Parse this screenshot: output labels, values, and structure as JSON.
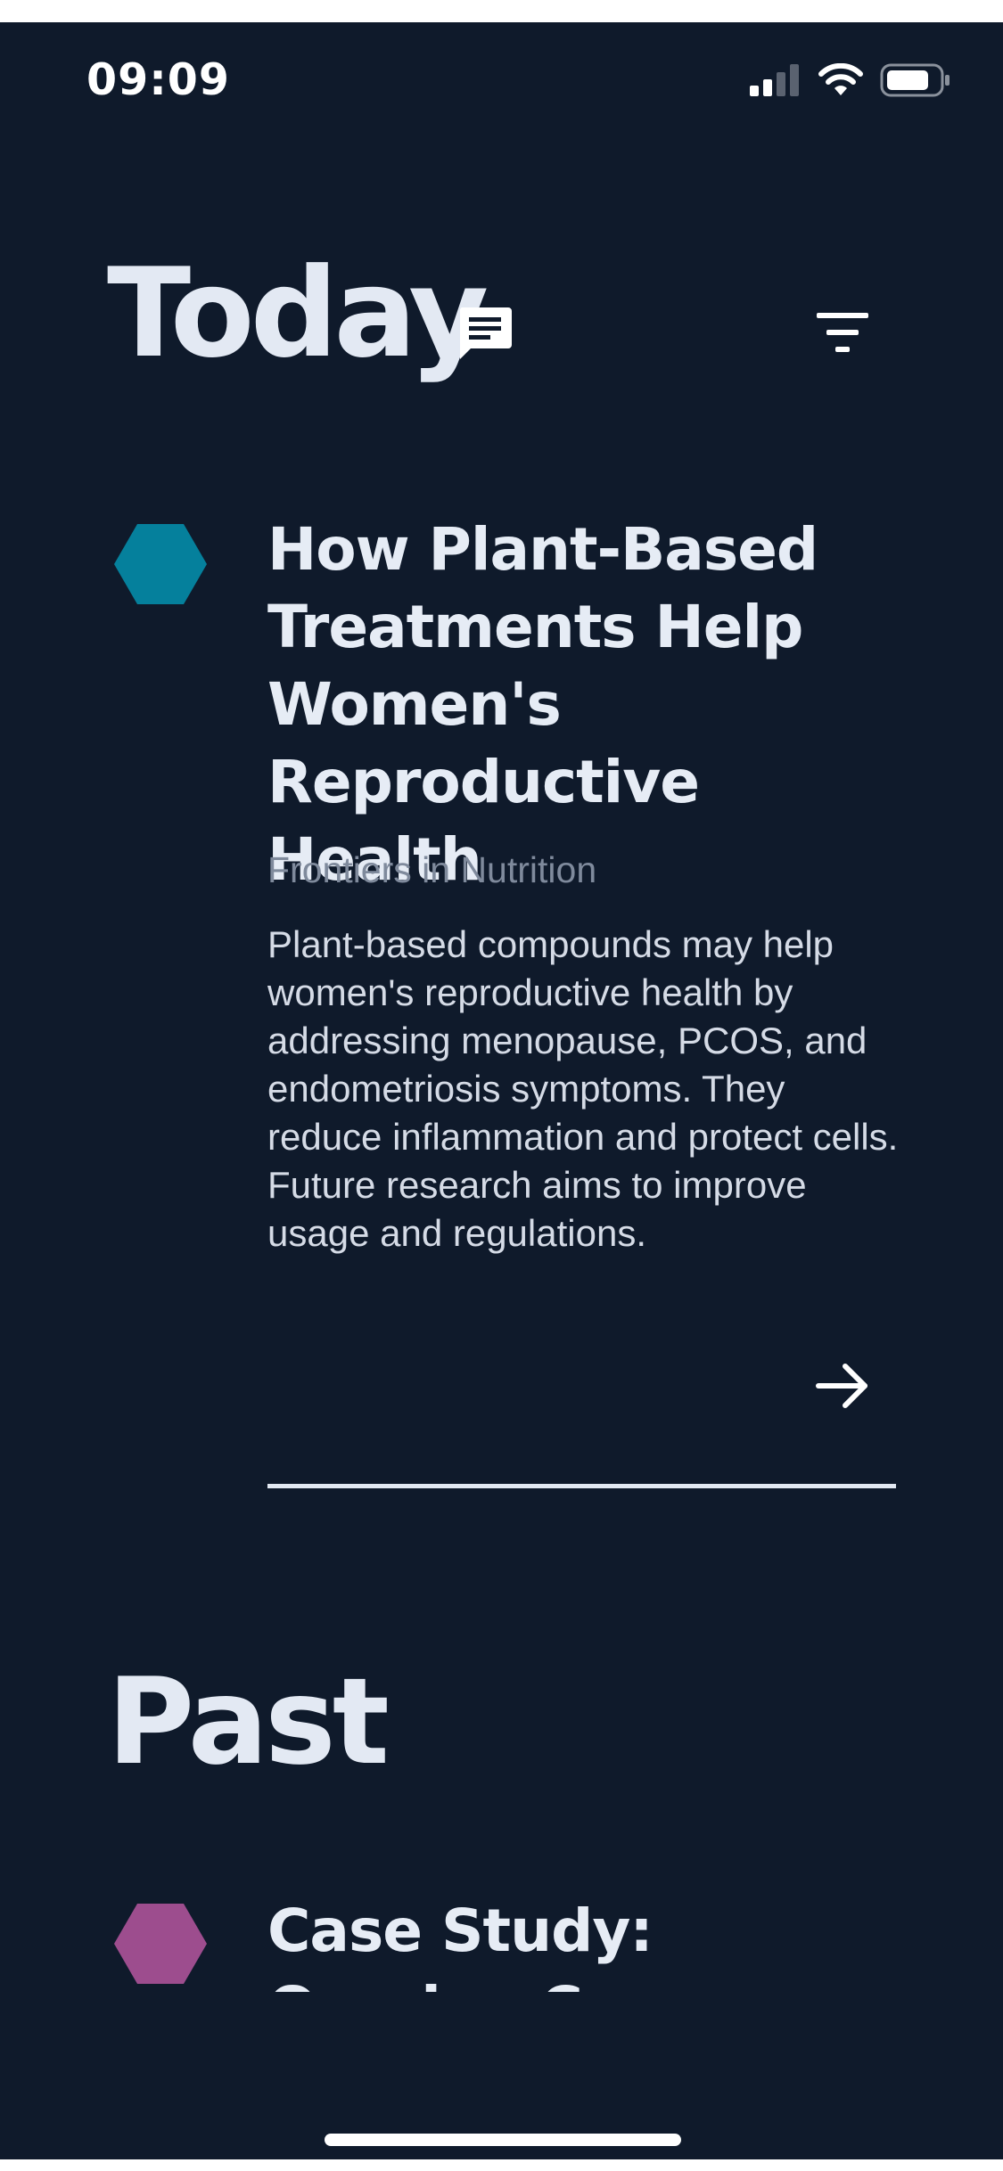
{
  "status_bar": {
    "time": "09:09",
    "icons": [
      "cellular-signal-icon",
      "wifi-icon",
      "battery-icon"
    ]
  },
  "header": {
    "title": "Today",
    "icons": [
      "chat-icon",
      "filter-icon"
    ]
  },
  "today_article": {
    "title": "How Plant-Based Treatments Help Women's Reproductive Health",
    "source": "Frontiers in Nutrition",
    "summary": "Plant-based compounds may help women's reproductive health by addressing menopause, PCOS, and endometriosis symptoms. They reduce inflammation and protect cells. Future research aims to improve usage and regulations.",
    "marker_color": "#05809c",
    "action_icon": "arrow-right-icon"
  },
  "past_section": {
    "title": "Past",
    "articles": [
      {
        "title": "Case Study: Ovarian Cancer Spreading to",
        "marker_color": "#9d4d8e"
      }
    ]
  },
  "colors": {
    "background": "#0f1a2b",
    "text_primary": "#e6ecf5",
    "text_muted": "#7f8a9c"
  }
}
